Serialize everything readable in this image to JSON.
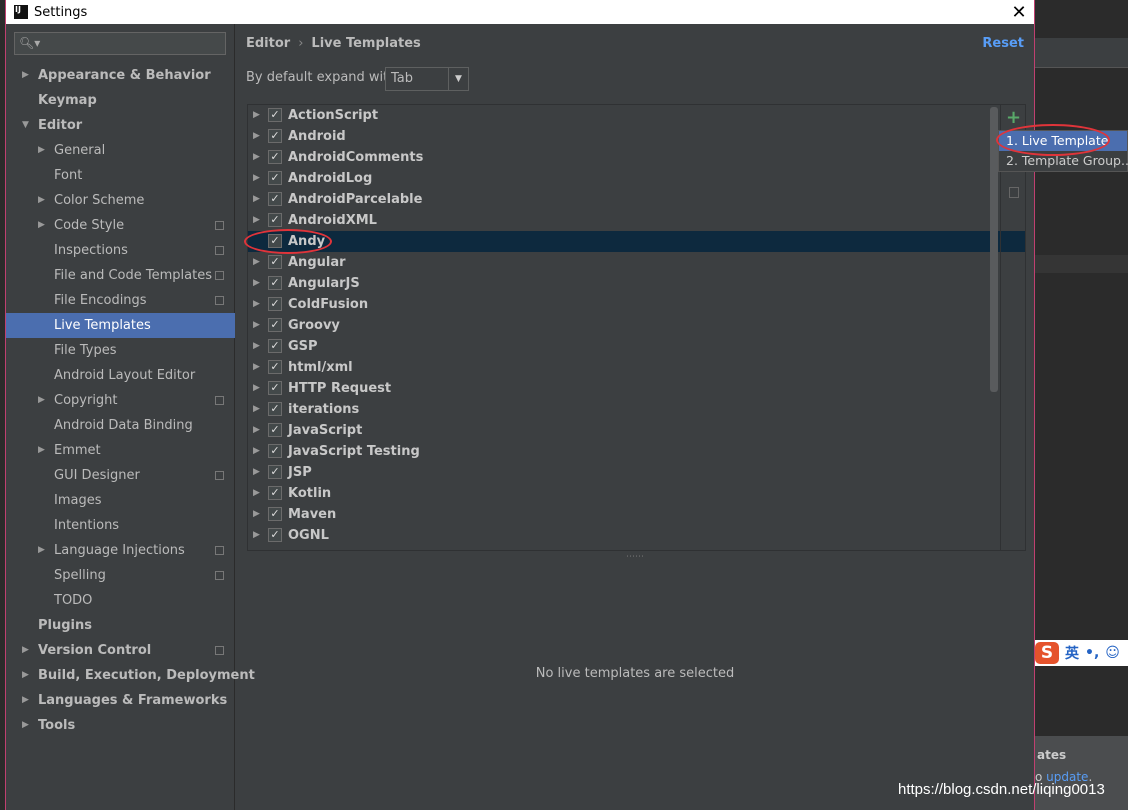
{
  "window": {
    "title": "Settings",
    "logo_text": "IJ",
    "close": "✕"
  },
  "sidebar": {
    "search_placeholder": "",
    "items": [
      {
        "label": "Appearance & Behavior",
        "level": 0,
        "arrow": "▶",
        "bold": true
      },
      {
        "label": "Keymap",
        "level": 0,
        "bold": true
      },
      {
        "label": "Editor",
        "level": 0,
        "arrow": "▼",
        "bold": true
      },
      {
        "label": "General",
        "level": 1,
        "arrow": "▶"
      },
      {
        "label": "Font",
        "level": 1
      },
      {
        "label": "Color Scheme",
        "level": 1,
        "arrow": "▶"
      },
      {
        "label": "Code Style",
        "level": 1,
        "arrow": "▶",
        "copy": true
      },
      {
        "label": "Inspections",
        "level": 1,
        "copy": true
      },
      {
        "label": "File and Code Templates",
        "level": 1,
        "copy": true
      },
      {
        "label": "File Encodings",
        "level": 1,
        "copy": true
      },
      {
        "label": "Live Templates",
        "level": 1,
        "selected": true
      },
      {
        "label": "File Types",
        "level": 1
      },
      {
        "label": "Android Layout Editor",
        "level": 1
      },
      {
        "label": "Copyright",
        "level": 1,
        "arrow": "▶",
        "copy": true
      },
      {
        "label": "Android Data Binding",
        "level": 1
      },
      {
        "label": "Emmet",
        "level": 1,
        "arrow": "▶"
      },
      {
        "label": "GUI Designer",
        "level": 1,
        "copy": true
      },
      {
        "label": "Images",
        "level": 1
      },
      {
        "label": "Intentions",
        "level": 1
      },
      {
        "label": "Language Injections",
        "level": 1,
        "arrow": "▶",
        "copy": true
      },
      {
        "label": "Spelling",
        "level": 1,
        "copy": true
      },
      {
        "label": "TODO",
        "level": 1
      },
      {
        "label": "Plugins",
        "level": 0,
        "bold": true
      },
      {
        "label": "Version Control",
        "level": 0,
        "arrow": "▶",
        "bold": true,
        "copy": true
      },
      {
        "label": "Build, Execution, Deployment",
        "level": 0,
        "arrow": "▶",
        "bold": true
      },
      {
        "label": "Languages & Frameworks",
        "level": 0,
        "arrow": "▶",
        "bold": true
      },
      {
        "label": "Tools",
        "level": 0,
        "arrow": "▶",
        "bold": true
      }
    ]
  },
  "main": {
    "breadcrumb": [
      "Editor",
      "Live Templates"
    ],
    "breadcrumb_sep": "›",
    "reset": "Reset",
    "expand_label": "By default expand with",
    "expand_value": "Tab",
    "templates": [
      {
        "name": "ActionScript",
        "checked": true
      },
      {
        "name": "Android",
        "checked": true
      },
      {
        "name": "AndroidComments",
        "checked": true
      },
      {
        "name": "AndroidLog",
        "checked": true
      },
      {
        "name": "AndroidParcelable",
        "checked": true
      },
      {
        "name": "AndroidXML",
        "checked": true
      },
      {
        "name": "Andy",
        "checked": true,
        "selected": true,
        "leaf": true
      },
      {
        "name": "Angular",
        "checked": true
      },
      {
        "name": "AngularJS",
        "checked": true
      },
      {
        "name": "ColdFusion",
        "checked": true
      },
      {
        "name": "Groovy",
        "checked": true
      },
      {
        "name": "GSP",
        "checked": true
      },
      {
        "name": "html/xml",
        "checked": true
      },
      {
        "name": "HTTP Request",
        "checked": true
      },
      {
        "name": "iterations",
        "checked": true
      },
      {
        "name": "JavaScript",
        "checked": true
      },
      {
        "name": "JavaScript Testing",
        "checked": true
      },
      {
        "name": "JSP",
        "checked": true
      },
      {
        "name": "Kotlin",
        "checked": true
      },
      {
        "name": "Maven",
        "checked": true
      },
      {
        "name": "OGNL",
        "checked": true
      }
    ],
    "add_icon": "+",
    "empty_text": "No live templates are selected"
  },
  "popup": {
    "items": [
      "1. Live Template",
      "2. Template Group..."
    ],
    "selected": 0
  },
  "background": {
    "notif_title": "ates",
    "notif_text": "o ",
    "notif_link": "update",
    "notif_end": "."
  },
  "ime": {
    "logo": "S",
    "lang": "英",
    "punct": "•,",
    "emoji": "☺"
  },
  "watermark": "https://blog.csdn.net/liqing0013",
  "colors": {
    "selection": "#4b6eaf",
    "row_selected": "#0d293e",
    "link": "#589df6",
    "annotation": "#e0343a",
    "add": "#59a869"
  }
}
